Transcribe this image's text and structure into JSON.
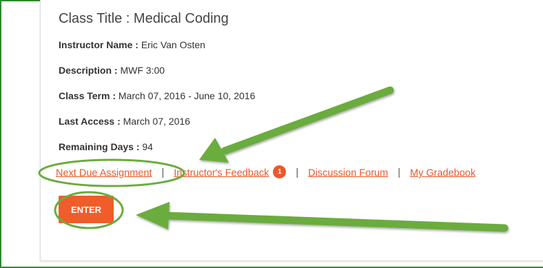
{
  "class": {
    "title": "Class Title : Medical Coding",
    "fields": [
      {
        "label": "Instructor Name :",
        "value": "Eric Van Osten"
      },
      {
        "label": "Description :",
        "value": "MWF 3:00"
      },
      {
        "label": "Class Term :",
        "value": "March 07, 2016 - June 10, 2016"
      },
      {
        "label": "Last Access :",
        "value": "March 07, 2016"
      },
      {
        "label": "Remaining Days :",
        "value": "94"
      }
    ]
  },
  "links": {
    "next_due": "Next Due Assignment",
    "feedback": "Instructor's Feedback",
    "feedback_count": "1",
    "forum": "Discussion Forum",
    "gradebook": "My Gradebook",
    "separator": "|"
  },
  "enter_button": "ENTER",
  "colors": {
    "accent": "#ef5d2a",
    "annotation": "#6aac3c",
    "frame": "#2f8a2f"
  }
}
